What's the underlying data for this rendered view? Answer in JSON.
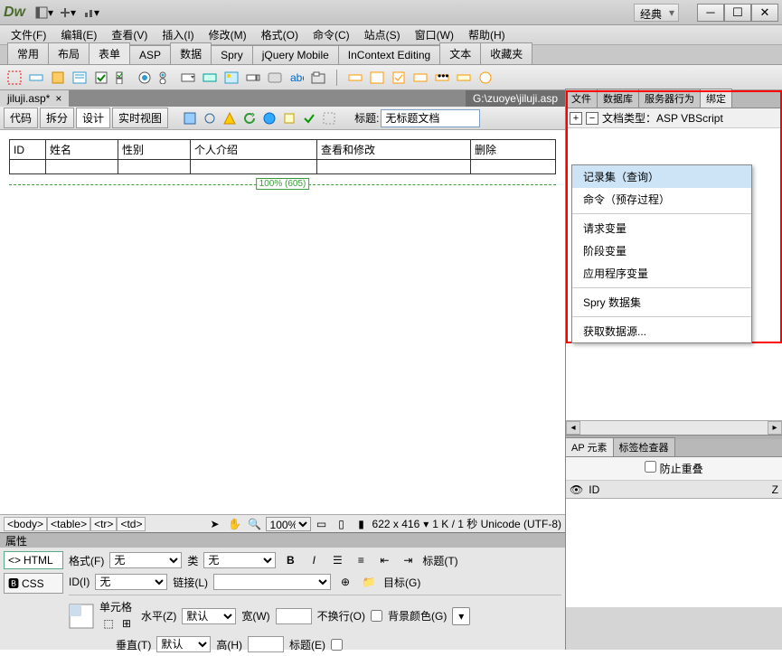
{
  "title_bar": {
    "workspace": "经典"
  },
  "menus": [
    "文件(F)",
    "编辑(E)",
    "查看(V)",
    "插入(I)",
    "修改(M)",
    "格式(O)",
    "命令(C)",
    "站点(S)",
    "窗口(W)",
    "帮助(H)"
  ],
  "insert_tabs": [
    "常用",
    "布局",
    "表单",
    "ASP",
    "数据",
    "Spry",
    "jQuery Mobile",
    "InContext Editing",
    "文本",
    "收藏夹"
  ],
  "insert_active": "表单",
  "doc": {
    "tab_name": "jiluji.asp*",
    "path": "G:\\zuoye\\jiluji.asp"
  },
  "view_buttons": [
    "代码",
    "拆分",
    "设计",
    "实时视图"
  ],
  "view_active": "设计",
  "doc_title_label": "标题:",
  "doc_title_value": "无标题文档",
  "table_headers": [
    "ID",
    "姓名",
    "性别",
    "个人介绍",
    "查看和修改",
    "删除"
  ],
  "ruler_label": "100% (605)",
  "tag_path": [
    "<body>",
    "<table>",
    "<tr>",
    "<td>"
  ],
  "zoom": "100%",
  "dims": "622 x 416",
  "status_info": "1 K / 1 秒 Unicode (UTF-8)",
  "props": {
    "header": "属性",
    "mode_html": "HTML",
    "mode_css": "CSS",
    "format_label": "格式(F)",
    "format_value": "无",
    "class_label": "类",
    "class_value": "无",
    "id_label": "ID(I)",
    "id_value": "无",
    "link_label": "链接(L)",
    "title_label": "标题(T)",
    "target_label": "目标(G)",
    "cell_label": "单元格",
    "horiz_label": "水平(Z)",
    "horiz_value": "默认",
    "width_label": "宽(W)",
    "nowrap_label": "不换行(O)",
    "bgcolor_label": "背景颜色(G)",
    "vert_label": "垂直(T)",
    "vert_value": "默认",
    "height_label": "高(H)",
    "header_chk_label": "标题(E)"
  },
  "panels": {
    "bind_tabs": [
      "文件",
      "数据库",
      "服务器行为",
      "绑定"
    ],
    "bind_active": "绑定",
    "doc_type_label": "文档类型：ASP VBScript",
    "context_menu": [
      "记录集（查询）",
      "命令（预存过程）",
      "请求变量",
      "阶段变量",
      "应用程序变量",
      "Spry 数据集",
      "获取数据源..."
    ],
    "cm_highlight": 0,
    "ap_tabs": [
      "AP 元素",
      "标签检查器"
    ],
    "ap_active": "AP 元素",
    "ap_overlap_label": "防止重叠",
    "ap_cols": {
      "id": "ID",
      "z": "Z"
    }
  }
}
